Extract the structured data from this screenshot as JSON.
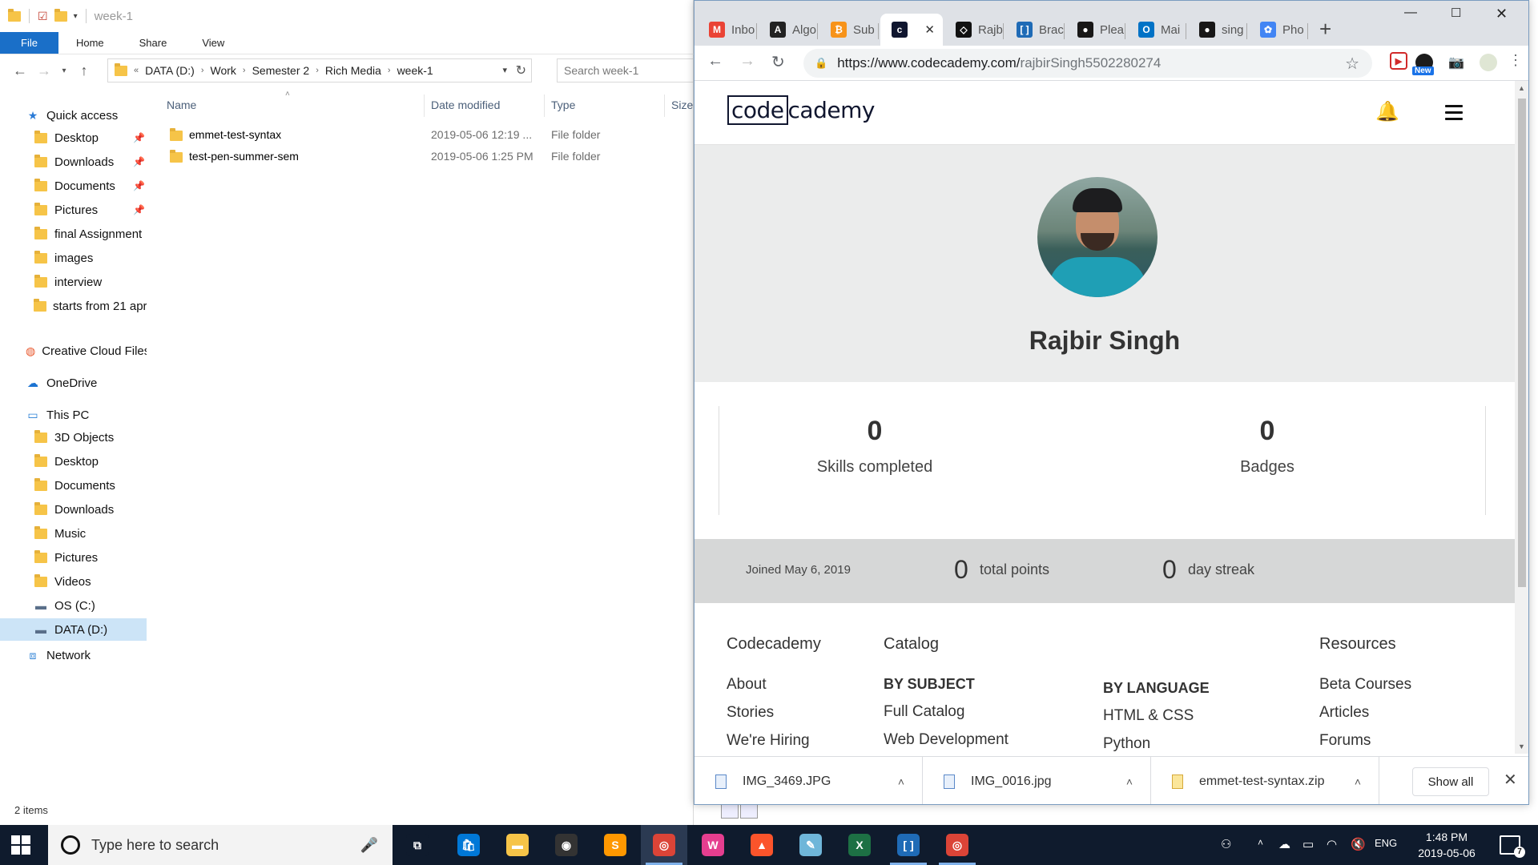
{
  "explorer": {
    "title": "week-1",
    "ribbon_tabs": [
      "File",
      "Home",
      "Share",
      "View"
    ],
    "breadcrumb": [
      "DATA (D:)",
      "Work",
      "Semester 2",
      "Rich Media",
      "week-1"
    ],
    "search_placeholder": "Search week-1",
    "nav": {
      "quick_access": "Quick access",
      "quick_items": [
        {
          "label": "Desktop",
          "icon": "desktop-folder-icon",
          "pinned": true
        },
        {
          "label": "Downloads",
          "icon": "downloads-folder-icon",
          "pinned": true
        },
        {
          "label": "Documents",
          "icon": "documents-folder-icon",
          "pinned": true
        },
        {
          "label": "Pictures",
          "icon": "pictures-folder-icon",
          "pinned": true
        },
        {
          "label": "final Assignment",
          "icon": "folder-icon",
          "pinned": false
        },
        {
          "label": "images",
          "icon": "folder-icon",
          "pinned": false
        },
        {
          "label": "interview",
          "icon": "folder-icon",
          "pinned": false
        },
        {
          "label": "starts from 21 apr",
          "icon": "folder-icon",
          "pinned": false
        }
      ],
      "creative_cloud": "Creative Cloud Files",
      "onedrive": "OneDrive",
      "this_pc": "This PC",
      "pc_items": [
        "3D Objects",
        "Desktop",
        "Documents",
        "Downloads",
        "Music",
        "Pictures",
        "Videos",
        "OS (C:)",
        "DATA (D:)"
      ],
      "network": "Network"
    },
    "columns": [
      "Name",
      "Date modified",
      "Type",
      "Size"
    ],
    "rows": [
      {
        "name": "emmet-test-syntax",
        "date": "2019-05-06 12:19 ...",
        "type": "File folder"
      },
      {
        "name": "test-pen-summer-sem",
        "date": "2019-05-06 1:25 PM",
        "type": "File folder"
      }
    ],
    "status": "2 items"
  },
  "chrome": {
    "tabs": [
      {
        "label": "Inbo",
        "icon": "gmail-icon",
        "color": "#ea4335",
        "glyph": "M"
      },
      {
        "label": "Algo",
        "icon": "algo-icon",
        "color": "#222222",
        "glyph": "A"
      },
      {
        "label": "Sub",
        "icon": "bitcoin-icon",
        "color": "#f7931a",
        "glyph": "₿"
      },
      {
        "label": "",
        "icon": "codecademy-icon",
        "color": "#10162f",
        "glyph": "c"
      },
      {
        "label": "Rajb",
        "icon": "codepen-icon",
        "color": "#111111",
        "glyph": "◇"
      },
      {
        "label": "Brac",
        "icon": "brackets-icon",
        "color": "#1f6bb6",
        "glyph": "[ ]"
      },
      {
        "label": "Plea",
        "icon": "github-icon",
        "color": "#181717",
        "glyph": "●"
      },
      {
        "label": "Mai",
        "icon": "outlook-icon",
        "color": "#0072c6",
        "glyph": "O"
      },
      {
        "label": "sing",
        "icon": "github-icon",
        "color": "#181717",
        "glyph": "●"
      },
      {
        "label": "Pho",
        "icon": "photos-icon",
        "color": "#4285f4",
        "glyph": "✿"
      }
    ],
    "url_host": "https://www.codecademy.com/",
    "url_path": "rajbirSingh5502280274",
    "extension_new_badge": "New"
  },
  "site": {
    "logo_code": "code",
    "logo_rest": "cademy",
    "profile_name": "Rajbir Singh",
    "stats": [
      {
        "value": "0",
        "label": "Skills completed"
      },
      {
        "value": "0",
        "label": "Badges"
      }
    ],
    "joined": "Joined May 6, 2019",
    "total_points": "0",
    "total_points_label": "total points",
    "day_streak": "0",
    "day_streak_label": "day streak",
    "footer": {
      "codecademy": {
        "head": "Codecademy",
        "items": [
          "About",
          "Stories",
          "We're Hiring"
        ]
      },
      "catalog": {
        "head": "Catalog",
        "subject_head": "BY SUBJECT",
        "subject_items": [
          "Full Catalog",
          "Web Development"
        ],
        "language_head": "BY LANGUAGE",
        "language_items": [
          "HTML & CSS",
          "Python"
        ]
      },
      "resources": {
        "head": "Resources",
        "items": [
          "Beta Courses",
          "Articles",
          "Forums"
        ]
      }
    }
  },
  "downloads": {
    "items": [
      {
        "name": "IMG_3469.JPG",
        "icon": "image-file-icon"
      },
      {
        "name": "IMG_0016.jpg",
        "icon": "image-file-icon"
      },
      {
        "name": "emmet-test-syntax.zip",
        "icon": "zip-file-icon"
      }
    ],
    "show_all": "Show all"
  },
  "taskbar": {
    "search_placeholder": "Type here to search",
    "apps": [
      {
        "name": "task-view-app",
        "color": "#0f1b2d",
        "glyph": "⧉"
      },
      {
        "name": "store-app",
        "color": "#0078d7",
        "glyph": "🛍"
      },
      {
        "name": "file-explorer-app",
        "color": "#f6c448",
        "glyph": "▬"
      },
      {
        "name": "camera-app",
        "color": "#333333",
        "glyph": "◉"
      },
      {
        "name": "sublime-app",
        "color": "#ff9800",
        "glyph": "S"
      },
      {
        "name": "chrome-app",
        "color": "#db4437",
        "glyph": "◎"
      },
      {
        "name": "webstorm-app",
        "color": "#e53e8f",
        "glyph": "W"
      },
      {
        "name": "brave-app",
        "color": "#fb542b",
        "glyph": "▲"
      },
      {
        "name": "notepad-app",
        "color": "#6fb6d9",
        "glyph": "✎"
      },
      {
        "name": "excel-app",
        "color": "#1d7044",
        "glyph": "X"
      },
      {
        "name": "brackets-app",
        "color": "#1f6bb6",
        "glyph": "[ ]"
      },
      {
        "name": "chrome-app-2",
        "color": "#db4437",
        "glyph": "◎"
      }
    ],
    "language": "ENG",
    "time": "1:48 PM",
    "date": "2019-05-06",
    "notification_count": "7"
  }
}
